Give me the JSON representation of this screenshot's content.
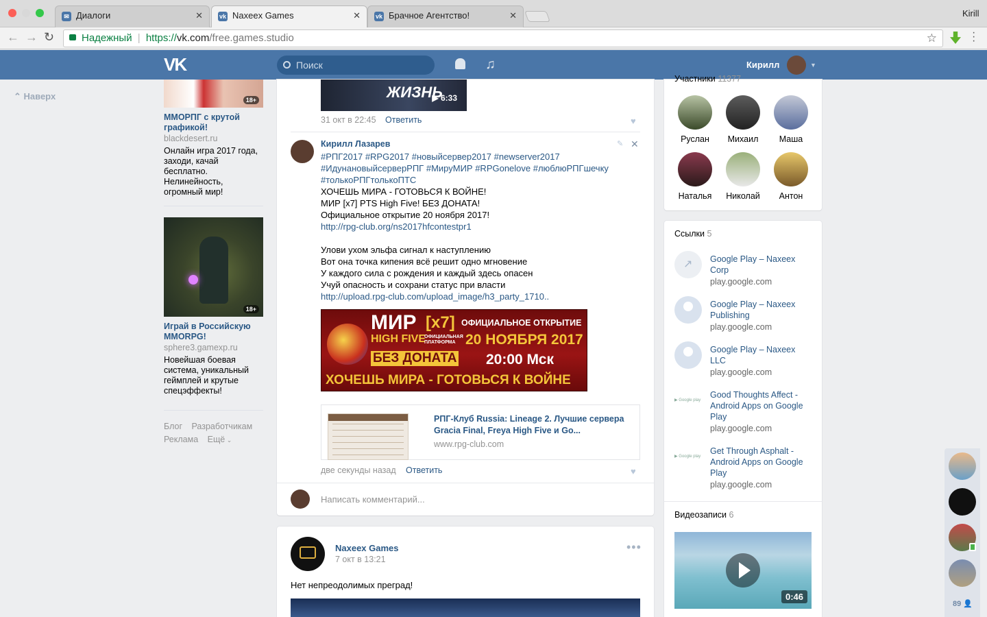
{
  "browser": {
    "profile": "Kirill",
    "tabs": [
      {
        "label": "Диалоги"
      },
      {
        "label": "Naxeex Games"
      },
      {
        "label": "Брачное Агентство!"
      }
    ],
    "secure_label": "Надежный",
    "url_scheme": "https://",
    "url_host": "vk.com",
    "url_path": "/free.games.studio"
  },
  "header": {
    "search_placeholder": "Поиск",
    "user_name": "Кирилл"
  },
  "left": {
    "back_to_top": "Наверх",
    "ads": [
      {
        "title": "ММОРПГ с крутой графикой!",
        "domain": "blackdesert.ru",
        "text": "Онлайн игра 2017 года, заходи, качай бесплатно. Нелинейность, огромный мир!",
        "badge": "18+"
      },
      {
        "title": "Играй в Российскую MMORPG!",
        "domain": "sphere3.gamexp.ru",
        "text": "Новейшая боевая система, уникальный геймплей и крутые спецэффекты!",
        "badge": "18+"
      }
    ],
    "footer": {
      "blog": "Блог",
      "developers": "Разработчикам",
      "ads": "Реклама",
      "more": "Ещё"
    }
  },
  "feed": {
    "prev_video_overlay": "ЖИЗНЬ",
    "prev_video_duration": "6:33",
    "prev_meta": {
      "date": "31 окт в 22:45",
      "reply": "Ответить"
    },
    "comment": {
      "author": "Кирилл Лазарев",
      "lines": [
        "#РПГ2017 #RPG2017 #новыйсервер2017 #newserver2017",
        "#ИдунановыйсерверРПГ #МируМИР #RPGonelove #люблюРПГшечку",
        "#толькоРПГтолькоПТС",
        "ХОЧЕШЬ МИРА - ГОТОВЬСЯ К ВОЙНЕ!",
        "МИР [x7] PTS High Five! БЕЗ ДОНАТА!",
        "Официальное открытие 20 ноября 2017!",
        "http://rpg-club.org/ns2017hfcontestpr1",
        "",
        "Улови ухом эльфа сигнал к наступлению",
        "Вот она точка кипения всё решит одно мгновение",
        "У каждого сила с рождения и каждый здесь опасен",
        "Учуй опасность и сохрани статус при власти",
        "http://upload.rpg-club.com/upload_image/h3_party_1710.."
      ],
      "banner": {
        "mir": "МИР",
        "x7": "[x7]",
        "highfive": "HIGH FIVE",
        "platform": "ОФИЦИАЛЬНАЯ ПЛАТФОРМА",
        "nodonate": "БЕЗ ДОНАТА",
        "official": "ОФИЦИАЛЬНОЕ ОТКРЫТИЕ",
        "date": "20 НОЯБРЯ 2017",
        "time": "20:00 Мск",
        "slogan": "ХОЧЕШЬ МИРА - ГОТОВЬСЯ К ВОЙНЕ"
      },
      "link_title": "РПГ-Клуб Russia: Lineage 2. Лучшие сервера Gracia Final, Freya High Five и Go...",
      "link_domain": "www.rpg-club.com",
      "time": "две секунды назад",
      "reply": "Ответить"
    },
    "comment_placeholder": "Написать комментарий...",
    "post": {
      "author": "Naxeex Games",
      "date": "7 окт в 13:21",
      "text": "Нет непреодолимых преград!"
    }
  },
  "right": {
    "members": {
      "title": "Участники",
      "count": "11377",
      "people": [
        {
          "name": "Руслан"
        },
        {
          "name": "Михаил"
        },
        {
          "name": "Маша"
        },
        {
          "name": "Наталья"
        },
        {
          "name": "Николай"
        },
        {
          "name": "Антон"
        }
      ]
    },
    "links": {
      "title": "Ссылки",
      "count": "5",
      "items": [
        {
          "title": "Google Play – Naxeex Corp",
          "url": "play.google.com"
        },
        {
          "title": "Google Play – Naxeex Publishing",
          "url": "play.google.com"
        },
        {
          "title": "Google Play – Naxeex LLC",
          "url": "play.google.com"
        },
        {
          "title": "Good Thoughts Affect - Android Apps on Google Play",
          "url": "play.google.com"
        },
        {
          "title": "Get Through Asphalt - Android Apps on Google Play",
          "url": "play.google.com"
        }
      ]
    },
    "videos": {
      "title": "Видеозаписи",
      "count": "6",
      "duration": "0:46"
    }
  },
  "chat_bar": {
    "count": "89"
  },
  "colors": {
    "vk_blue": "#4a76a8",
    "link": "#2a5885",
    "secure_green": "#0b8043",
    "page_bg": "#edeef0"
  }
}
